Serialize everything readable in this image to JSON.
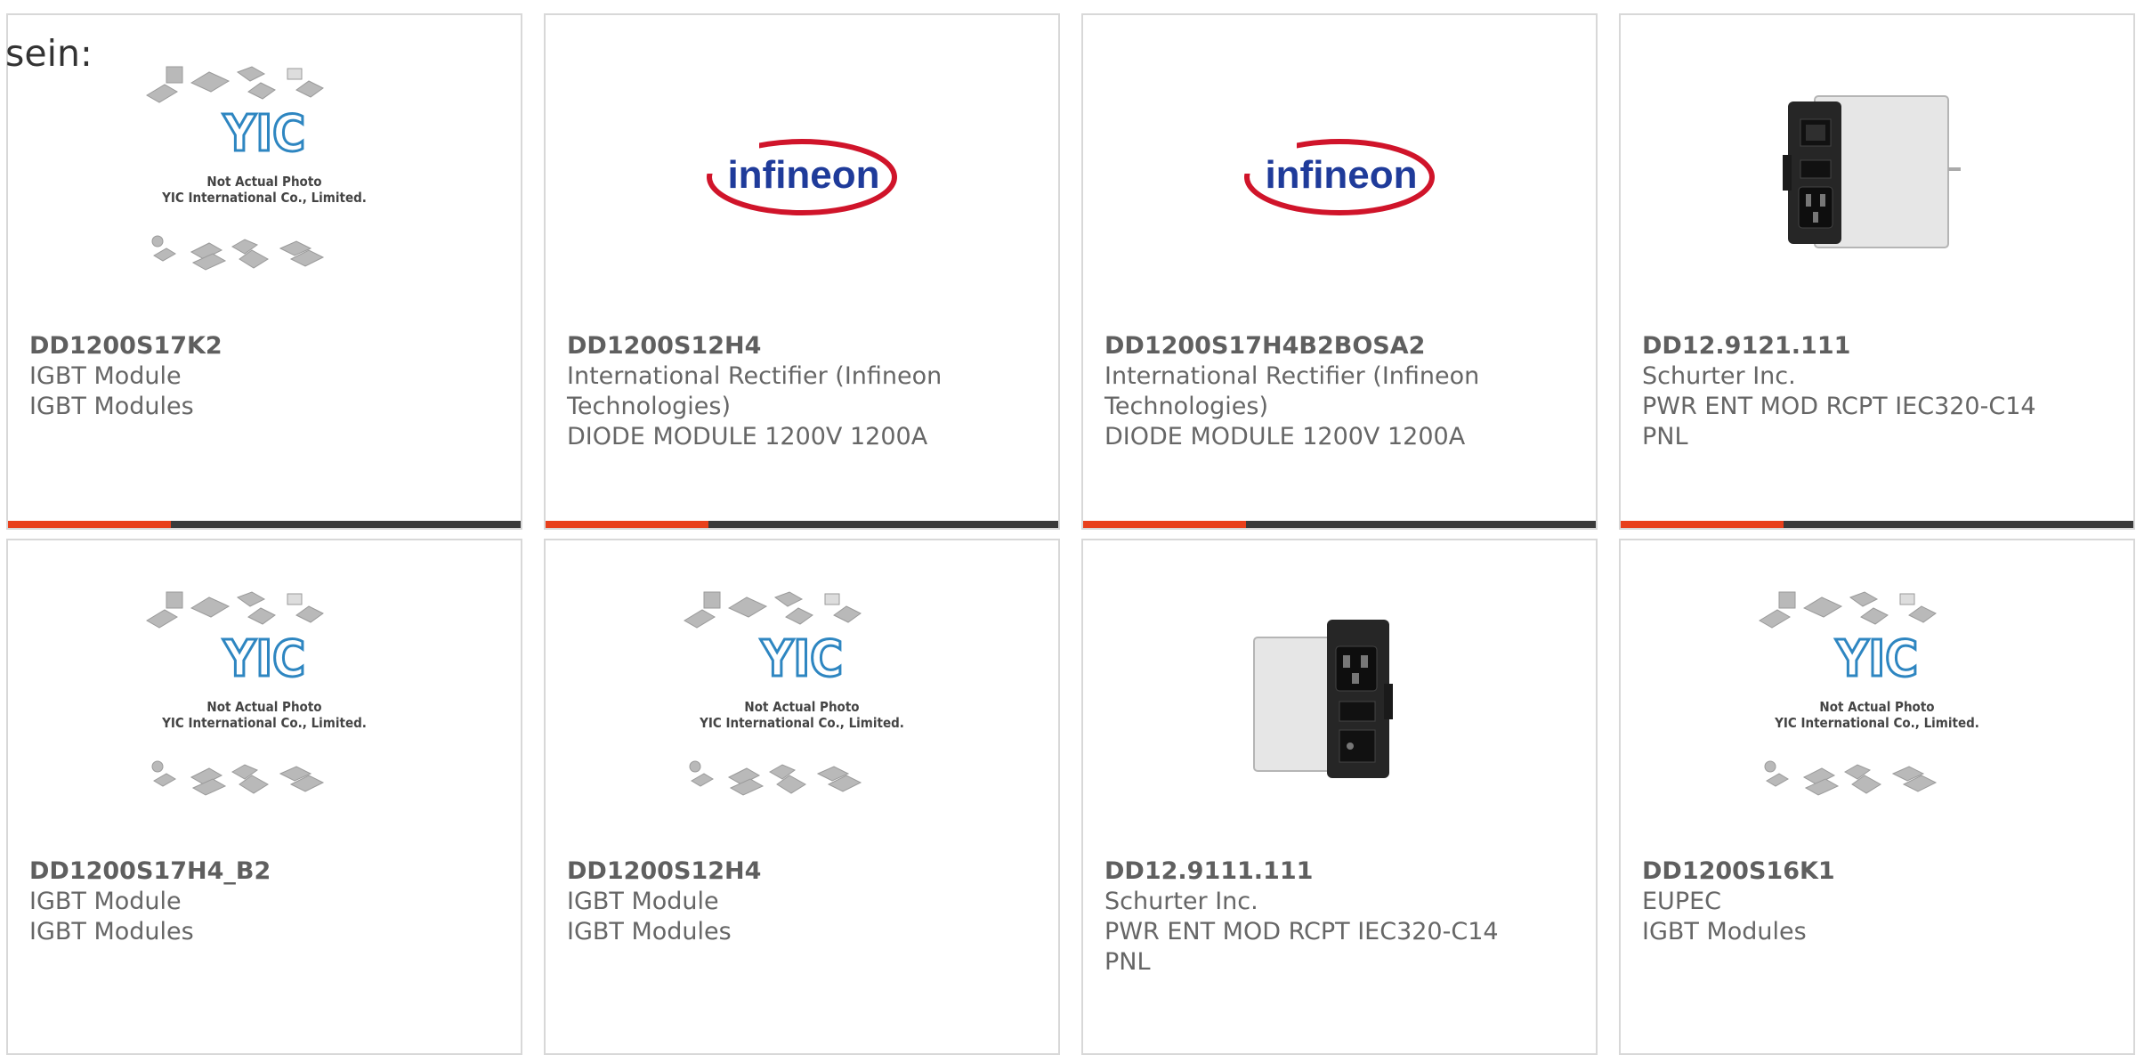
{
  "heading_partial": "sein:",
  "colors": {
    "accent": "#e8401c",
    "bar": "#3a3a3a",
    "yic_blue": "#2e86c1",
    "infineon_red": "#d0142a",
    "infineon_blue": "#1f3b9a"
  },
  "products": [
    {
      "part": "DD1200S17K2",
      "line1": "IGBT Module",
      "line2": "IGBT Modules",
      "line3": "",
      "image": "yic-placeholder",
      "accent_bar": true
    },
    {
      "part": "DD1200S12H4",
      "line1": "International Rectifier (Infineon",
      "line2": "Technologies)",
      "line3": "DIODE MODULE 1200V 1200A",
      "image": "infineon-logo",
      "accent_bar": true
    },
    {
      "part": "DD1200S17H4B2BOSA2",
      "line1": "International Rectifier (Infineon",
      "line2": "Technologies)",
      "line3": "DIODE MODULE 1200V 1200A",
      "image": "infineon-logo",
      "accent_bar": true
    },
    {
      "part": "DD12.9121.111",
      "line1": "Schurter Inc.",
      "line2": "PWR ENT MOD RCPT IEC320-C14",
      "line3": "PNL",
      "image": "power-entry-module-photo",
      "accent_bar": true
    },
    {
      "part": "DD1200S17H4_B2",
      "line1": "IGBT Module",
      "line2": "IGBT Modules",
      "line3": "",
      "image": "yic-placeholder",
      "accent_bar": false
    },
    {
      "part": "DD1200S12H4",
      "line1": "IGBT Module",
      "line2": "IGBT Modules",
      "line3": "",
      "image": "yic-placeholder",
      "accent_bar": false
    },
    {
      "part": "DD12.9111.111",
      "line1": "Schurter Inc.",
      "line2": "PWR ENT MOD RCPT IEC320-C14",
      "line3": "PNL",
      "image": "power-entry-module-photo",
      "accent_bar": false
    },
    {
      "part": "DD1200S16K1",
      "line1": "EUPEC",
      "line2": "IGBT Modules",
      "line3": "",
      "image": "yic-placeholder",
      "accent_bar": false
    }
  ],
  "placeholder": {
    "line1": "Not Actual Photo",
    "line2": "YIC International Co., Limited.",
    "logo": "YIC"
  },
  "infineon_logo_text": "infineon"
}
